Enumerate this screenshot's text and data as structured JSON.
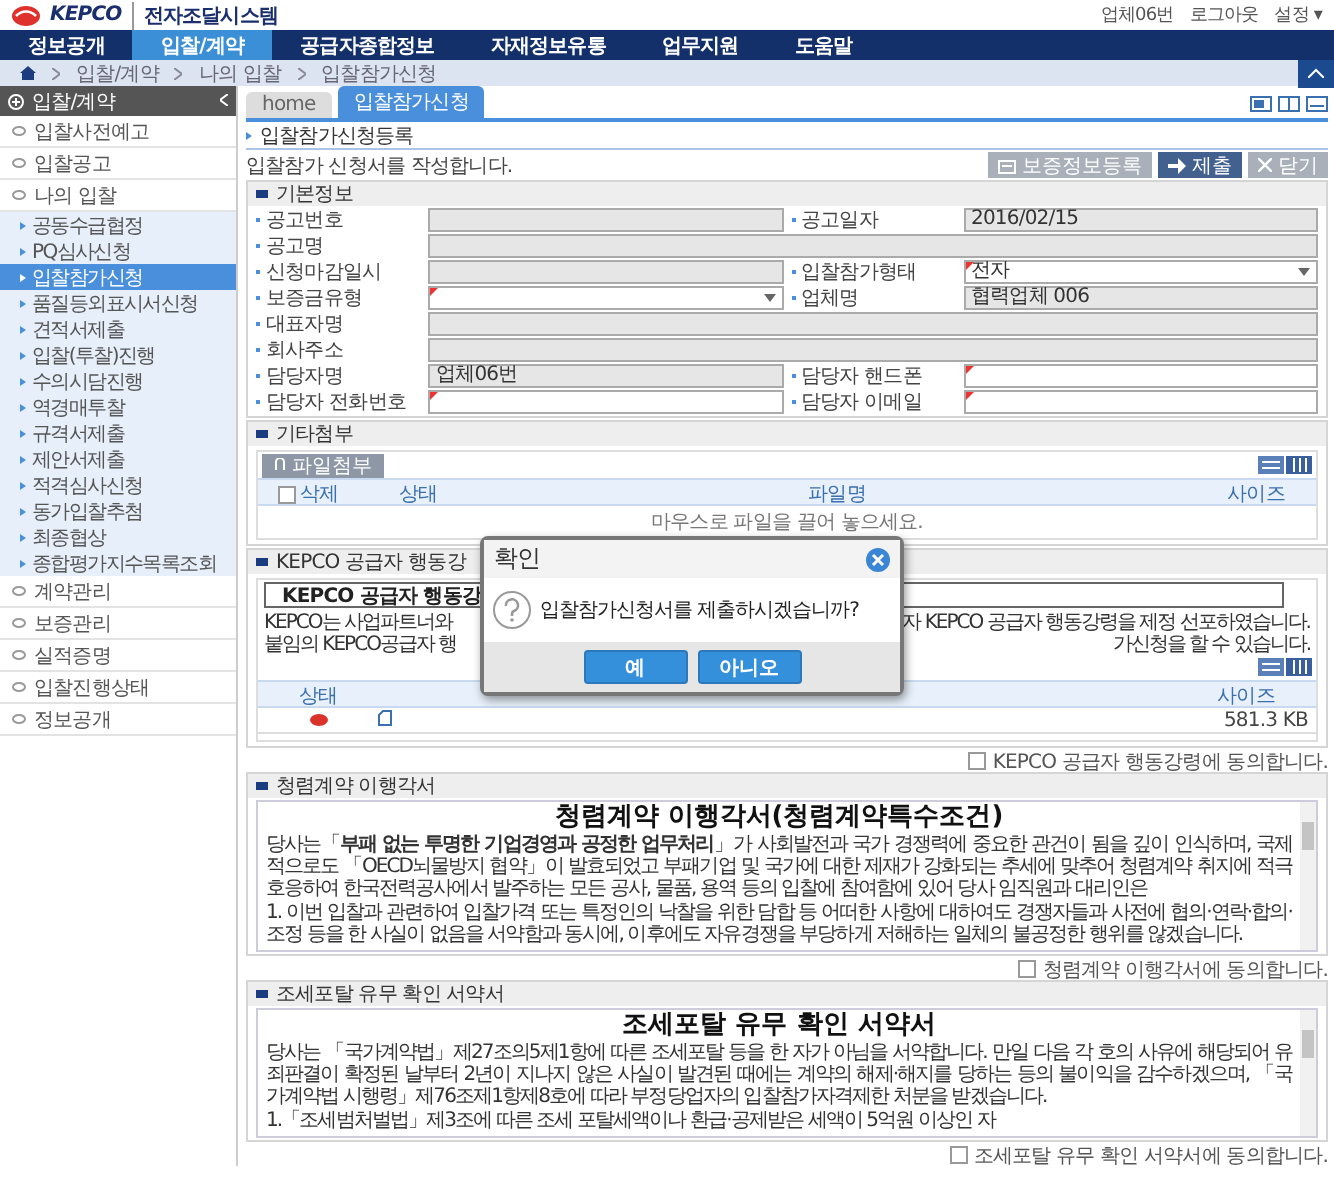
{
  "header": {
    "logo": "KEPCO",
    "system_name": "전자조달시스템",
    "user_links": [
      "업체06번",
      "로그아웃",
      "설정 ▾"
    ]
  },
  "nav": [
    {
      "label": "정보공개",
      "selected": false
    },
    {
      "label": "입찰/계약",
      "selected": true
    },
    {
      "label": "공급자종합정보",
      "selected": false
    },
    {
      "label": "자재정보유통",
      "selected": false
    },
    {
      "label": "업무지원",
      "selected": false
    },
    {
      "label": "도움말",
      "selected": false
    }
  ],
  "breadcrumb": [
    "입찰/계약",
    "나의 입찰",
    "입찰참가신청"
  ],
  "sidebar": {
    "title": "입찰/계약",
    "items": [
      {
        "label": "입찰사전예고",
        "selected": false
      },
      {
        "label": "입찰공고",
        "selected": false
      },
      {
        "label": "나의 입찰",
        "selected": false,
        "children": [
          {
            "label": "공동수급협정",
            "selected": false
          },
          {
            "label": "PQ심사신청",
            "selected": false
          },
          {
            "label": "입찰참가신청",
            "selected": true
          },
          {
            "label": "품질등외표시서신청",
            "selected": false
          },
          {
            "label": "견적서제출",
            "selected": false
          },
          {
            "label": "입찰(투찰)진행",
            "selected": false
          },
          {
            "label": "수의시담진행",
            "selected": false
          },
          {
            "label": "역경매투찰",
            "selected": false
          },
          {
            "label": "규격서제출",
            "selected": false
          },
          {
            "label": "제안서제출",
            "selected": false
          },
          {
            "label": "적격심사신청",
            "selected": false
          },
          {
            "label": "동가입찰추첨",
            "selected": false
          },
          {
            "label": "최종협상",
            "selected": false
          },
          {
            "label": "종합평가지수목록조회",
            "selected": false
          }
        ]
      },
      {
        "label": "계약관리",
        "selected": false
      },
      {
        "label": "보증관리",
        "selected": false
      },
      {
        "label": "실적증명",
        "selected": false
      },
      {
        "label": "입찰진행상태",
        "selected": false
      },
      {
        "label": "정보공개",
        "selected": false
      }
    ]
  },
  "tabs": [
    {
      "label": "home",
      "selected": false
    },
    {
      "label": "입찰참가신청",
      "selected": true
    }
  ],
  "page_title": "입찰참가신청등록",
  "description": "입찰참가 신청서를 작성합니다.",
  "actions": [
    {
      "label": "보증정보등록",
      "kind": "register"
    },
    {
      "label": "제출",
      "kind": "submit"
    },
    {
      "label": "닫기",
      "kind": "close"
    }
  ],
  "basic_info": {
    "title": "기본정보",
    "rows": [
      [
        {
          "label": "공고번호",
          "kind": "text",
          "required": false
        },
        {
          "label": "공고일자",
          "kind": "text",
          "required": false,
          "value": "2016/02/15"
        }
      ],
      [
        {
          "label": "공고명",
          "kind": "text",
          "required": false
        }
      ],
      [
        {
          "label": "신청마감일시",
          "kind": "text",
          "required": false
        },
        {
          "label": "입찰참가형태",
          "kind": "select",
          "required": true,
          "value": "전자"
        }
      ],
      [
        {
          "label": "보증금유형",
          "kind": "select",
          "required": true
        },
        {
          "label": "업체명",
          "kind": "text",
          "required": false,
          "value": "협력업체 006"
        }
      ],
      [
        {
          "label": "대표자명",
          "kind": "text",
          "required": false
        }
      ],
      [
        {
          "label": "회사주소",
          "kind": "text",
          "required": false
        }
      ],
      [
        {
          "label": "담당자명",
          "kind": "text",
          "required": false,
          "value": "업체06번"
        },
        {
          "label": "담당자 핸드폰",
          "kind": "text",
          "required": true
        }
      ],
      [
        {
          "label": "담당자 전화번호",
          "kind": "text",
          "required": true
        },
        {
          "label": "담당자 이메일",
          "kind": "text",
          "required": true
        }
      ]
    ]
  },
  "attachments": {
    "title": "기타첨부",
    "upload_button": "파일첨부",
    "select_all_checked": false,
    "columns": [
      "삭제",
      "상태",
      "파일명",
      "사이즈"
    ],
    "empty_text": "마우스로 파일을 끌어 놓으세요."
  },
  "code_of_conduct": {
    "title": "KEPCO 공급자 행동강",
    "notice_title": "KEPCO 공급자 행동강",
    "notice_lines": [
      {
        "left": "KEPCO는 사업파트너와",
        "right": "자 KEPCO 공급자 행동강령을 제정 선포하였습니다."
      },
      {
        "left": "붙임의 KEPCO공급자 행",
        "right": "가신청을 할 수 있습니다."
      }
    ],
    "columns": [
      "상태",
      "사이즈"
    ],
    "files": [
      {
        "size": "581.3 KB"
      }
    ],
    "agree": {
      "label": "KEPCO 공급자 행동강령에 동의합니다.",
      "checked": false
    }
  },
  "integrity_pledge": {
    "title": "청렴계약 이행각서",
    "document_title": "청렴계약 이행각서(청렴계약특수조건)",
    "paragraphs": [
      "당사는「**부패 없는 투명한 기업경영과 공정한 업무처리**」가 사회발전과 국가 경쟁력에 중요한 관건이 됨을 깊이 인식하며, 국제적으로도 「OECD뇌물방지 협약」이 발효되었고 부패기업 및 국가에 대한 제재가 강화되는 추세에 맞추어 청렴계약 취지에 적극 호응하여 한국전력공사에서 발주하는 모든 공사, 물품, 용역 등의 입찰에 참여함에 있어 당사 임직원과 대리인은",
      "1. 이번 입찰과 관련하여 입찰가격 또는 특정인의 낙찰을 위한 담합 등 어떠한 사항에 대하여도 경쟁자들과 사전에 협의·연락·합의·조정 등을 한 사실이 없음을 서약함과 동시에, 이후에도 자유경쟁을 부당하게 저해하는 일체의 불공정한 행위를 않겠습니다."
    ],
    "agree": {
      "label": "청렴계약 이행각서에 동의합니다.",
      "checked": false
    }
  },
  "tax_pledge": {
    "title": "조세포탈 유무 확인 서약서",
    "document_title": "조세포탈 유무 확인 서약서",
    "paragraphs": [
      "당사는 「국가계약법」제27조의5제1항에 따른 조세포탈 등을 한 자가 아님을 서약합니다. 만일 다음 각 호의 사유에 해당되어 유죄판결이 확정된 날부터 2년이 지나지 않은 사실이 발견된 때에는 계약의 해제·해지를 당하는 등의 불이익을 감수하겠으며, 「국가계약법 시행령」제76조제1항제8호에 따라 부정당업자의 입찰참가자격제한 처분을 받겠습니다.",
      "1.「조세범처벌법」제3조에 따른 조세 포탈세액이나 환급·공제받은 세액이 5억원 이상인 자"
    ],
    "agree": {
      "label": "조세포탈 유무 확인 서약서에 동의합니다.",
      "checked": false
    }
  },
  "dialog": {
    "title": "확인",
    "message": "입찰참가신청서를 제출하시겠습니까?",
    "buttons": [
      "예",
      "아니오"
    ]
  }
}
